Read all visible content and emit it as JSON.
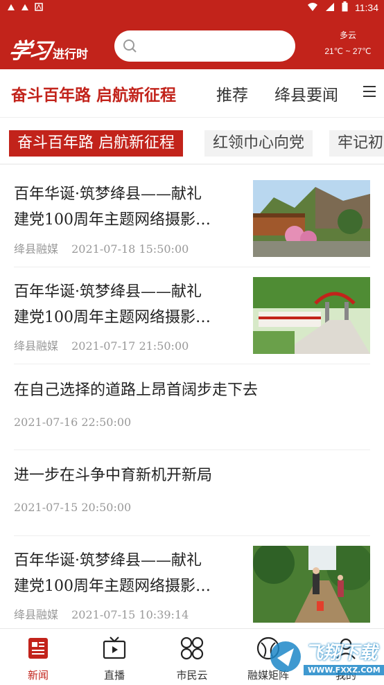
{
  "status_bar": {
    "time": "11:34"
  },
  "header": {
    "logo_script": "学习",
    "logo_sub": "进行时",
    "search_placeholder": "",
    "weather": {
      "condition": "多云",
      "temperature": "21℃ ~ 27℃"
    }
  },
  "nav_tabs": [
    {
      "label": "奋斗百年路 启航新征程",
      "active": true
    },
    {
      "label": "推荐"
    },
    {
      "label": "绛县要闻"
    }
  ],
  "sub_tabs": [
    {
      "label": "奋斗百年路 启航新征程",
      "active": true
    },
    {
      "label": "红领巾心向党"
    },
    {
      "label": "牢记初"
    }
  ],
  "news": [
    {
      "title_line1": "百年华诞·筑梦绛县——献礼",
      "title_line2": "建党100周年主题网络摄影…",
      "source": "绛县融媒",
      "time": "2021-07-18 15:50:00",
      "has_image": true
    },
    {
      "title_line1": "百年华诞·筑梦绛县——献礼",
      "title_line2": "建党100周年主题网络摄影…",
      "source": "绛县融媒",
      "time": "2021-07-17 21:50:00",
      "has_image": true
    },
    {
      "title_line1": "在自己选择的道路上昂首阔步走下去",
      "time": "2021-07-16 22:50:00",
      "has_image": false
    },
    {
      "title_line1": "进一步在斗争中育新机开新局",
      "time": "2021-07-15 20:50:00",
      "has_image": false
    },
    {
      "title_line1": "百年华诞·筑梦绛县——献礼",
      "title_line2": "建党100周年主题网络摄影…",
      "source": "绛县融媒",
      "time": "2021-07-15 10:39:14",
      "has_image": true
    }
  ],
  "bottom_nav": [
    {
      "label": "新闻",
      "icon": "news-icon",
      "active": true
    },
    {
      "label": "直播",
      "icon": "tv-icon"
    },
    {
      "label": "市民云",
      "icon": "apps-icon"
    },
    {
      "label": "融媒矩阵",
      "icon": "matrix-icon"
    },
    {
      "label": "我的",
      "icon": "user-icon"
    }
  ],
  "watermark": {
    "text": "飞翔下载",
    "url": "WWW.FXXZ.COM"
  },
  "colors": {
    "brand": "#c2231b",
    "meta": "#999999"
  }
}
